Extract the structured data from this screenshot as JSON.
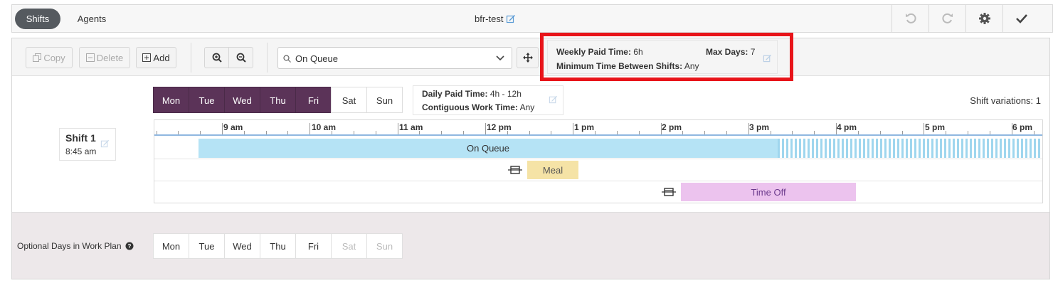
{
  "tabs": {
    "shifts": "Shifts",
    "agents": "Agents"
  },
  "plan": {
    "title": "bfr-test"
  },
  "toolbar": {
    "copy": "Copy",
    "delete": "Delete",
    "add": "Add",
    "activity_select": "On Queue"
  },
  "plan_settings": {
    "weekly_paid_label": "Weekly Paid Time:",
    "weekly_paid_value": "6h",
    "max_days_label": "Max Days:",
    "max_days_value": "7",
    "min_time_label": "Minimum Time Between Shifts:",
    "min_time_value": "Any"
  },
  "shift": {
    "days": [
      {
        "label": "Mon",
        "selected": true
      },
      {
        "label": "Tue",
        "selected": true
      },
      {
        "label": "Wed",
        "selected": true
      },
      {
        "label": "Thu",
        "selected": true
      },
      {
        "label": "Fri",
        "selected": true
      },
      {
        "label": "Sat",
        "selected": false
      },
      {
        "label": "Sun",
        "selected": false
      }
    ],
    "daily_paid_label": "Daily Paid Time:",
    "daily_paid_value": "4h - 12h",
    "contiguous_label": "Contiguous Work Time:",
    "contiguous_value": "Any",
    "variations": "Shift variations: 1",
    "name": "Shift 1",
    "start": "8:45 am"
  },
  "timeline": {
    "hours": [
      "9 am",
      "10 am",
      "11 am",
      "12 pm",
      "1 pm",
      "2 pm",
      "3 pm",
      "4 pm",
      "5 pm",
      "6 pm"
    ],
    "activities": {
      "on_queue": "On Queue",
      "meal": "Meal",
      "time_off": "Time Off"
    }
  },
  "optional": {
    "label": "Optional Days in Work Plan",
    "days": [
      {
        "label": "Mon",
        "enabled": true
      },
      {
        "label": "Tue",
        "enabled": true
      },
      {
        "label": "Wed",
        "enabled": true
      },
      {
        "label": "Thu",
        "enabled": true
      },
      {
        "label": "Fri",
        "enabled": true
      },
      {
        "label": "Sat",
        "enabled": false
      },
      {
        "label": "Sun",
        "enabled": false
      }
    ]
  },
  "colors": {
    "selected_day": "#5b3358",
    "on_queue": "#b5e3f5",
    "meal": "#f5e3a6",
    "time_off": "#ecc3ee",
    "highlight": "#e8141a"
  }
}
